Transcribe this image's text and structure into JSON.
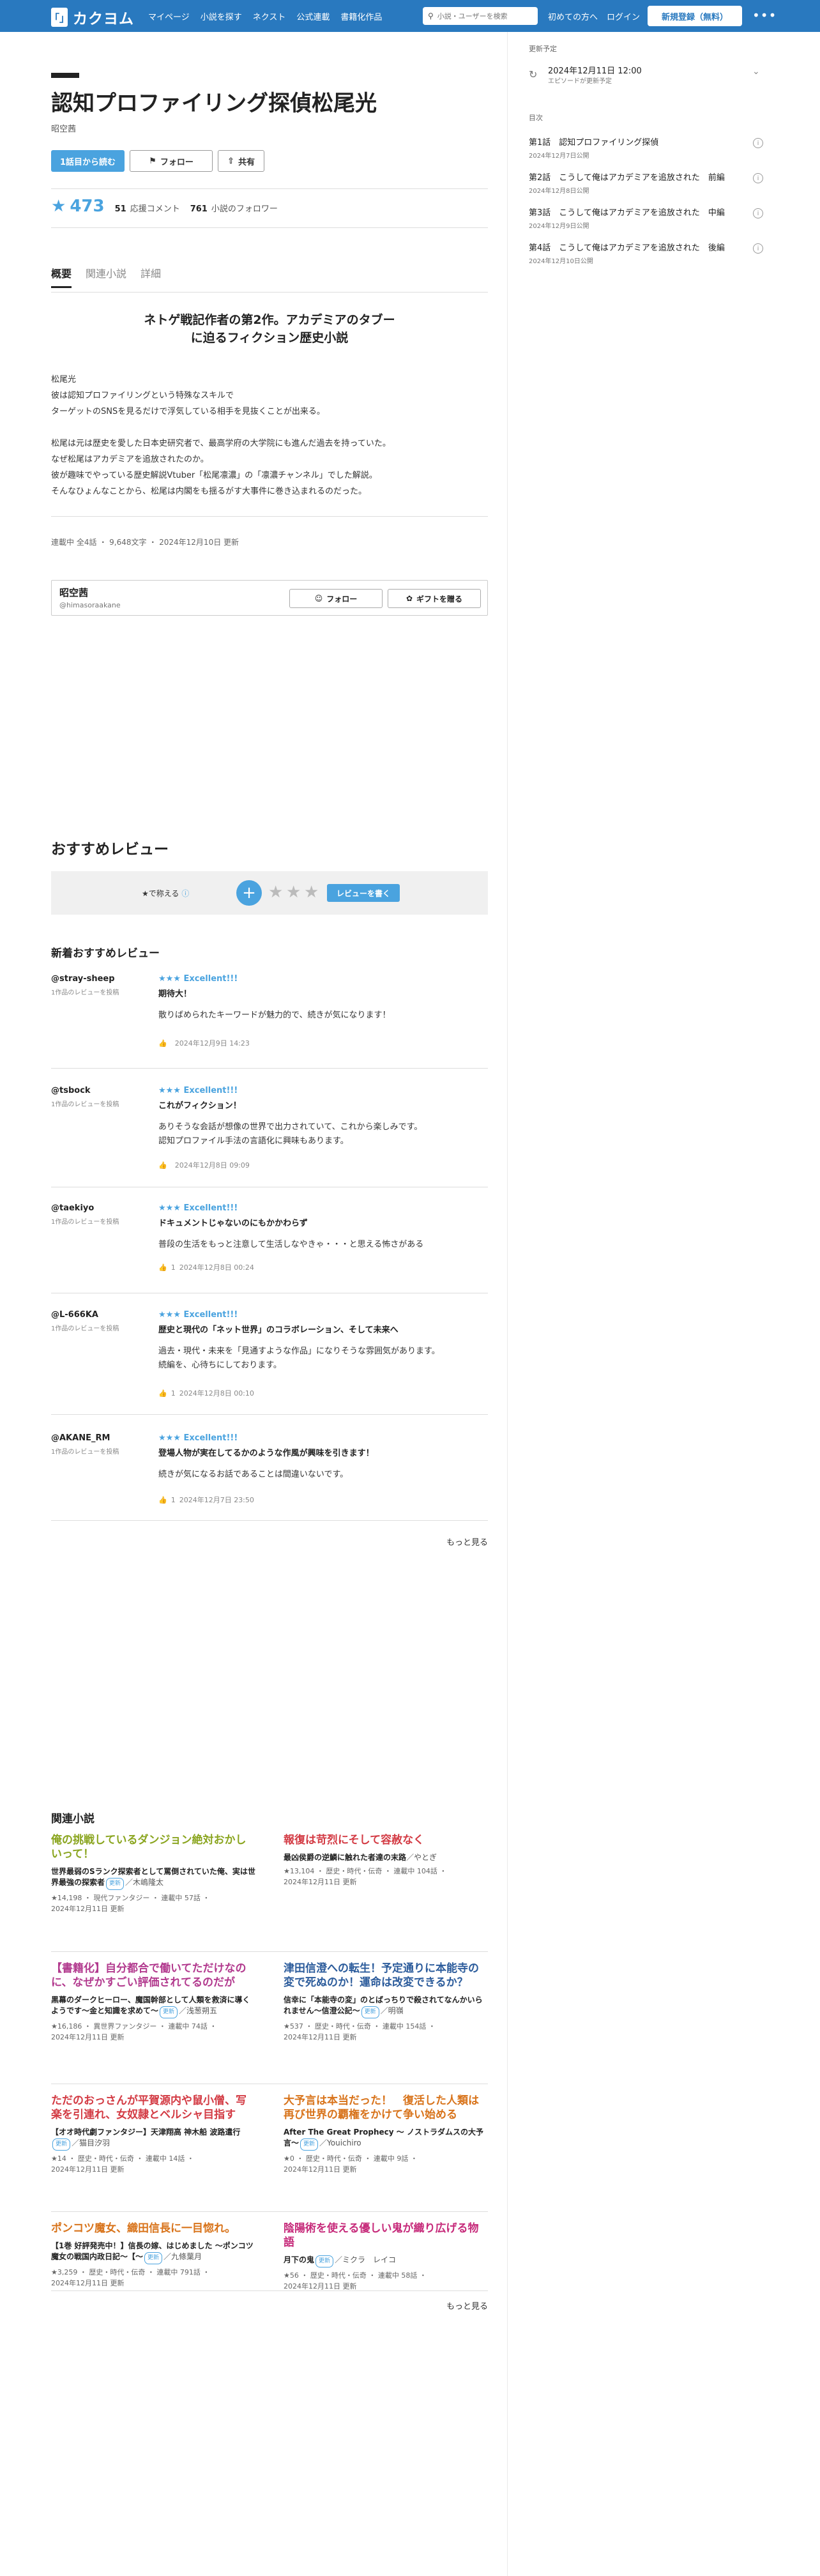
{
  "header": {
    "logo_mark": "「」",
    "logo_text": "カクヨム",
    "nav": [
      "マイページ",
      "小説を探す",
      "ネクスト",
      "公式連載",
      "書籍化作品"
    ],
    "search_placeholder": "小説・ユーザーを検索",
    "first_time": "初めての方へ",
    "login": "ログイン",
    "register": "新規登録（無料）",
    "more": "•••"
  },
  "work": {
    "title": "認知プロファイリング探偵松尾光",
    "author": "昭空茜",
    "read_first": "1話目から読む",
    "follow": "フォロー",
    "share": "共有",
    "score": "473",
    "comments_num": "51",
    "comments_label": "応援コメント",
    "followers_num": "761",
    "followers_label": "小説のフォロワー"
  },
  "tabs": [
    "概要",
    "関連小説",
    "詳細"
  ],
  "catch_line1": "ネトゲ戦記作者の第2作。アカデミアのタブー",
  "catch_line2": "に迫るフィクション歴史小説",
  "intro_lines": [
    "松尾光",
    "彼は認知プロファイリングという特殊なスキルで",
    "ターゲットのSNSを見るだけで浮気している相手を見抜くことが出来る。",
    "",
    "松尾は元は歴史を愛した日本史研究者で、最高学府の大学院にも進んだ過去を持っていた。",
    "なぜ松尾はアカデミアを追放されたのか。",
    "彼が趣味でやっている歴史解説Vtuber「松尾凛濃」の「凛濃チャンネル」でした解説。",
    "そんなひょんなことから、松尾は内閣をも揺るがす大事件に巻き込まれるのだった。"
  ],
  "meta": {
    "status": "連載中",
    "episodes": "全4話",
    "chars": "9,648文字",
    "updated": "2024年12月10日 更新"
  },
  "author_card": {
    "name": "昭空茜",
    "id": "@himasoraakane",
    "follow": "フォロー",
    "gift": "ギフトを贈る"
  },
  "recommend": {
    "title": "おすすめレビュー",
    "label": "★で称える",
    "write": "レビューを書く"
  },
  "new_reviews_title": "新着おすすめレビュー",
  "reviews": [
    {
      "user": "@stray-sheep",
      "count": "1作品のレビューを投稿",
      "rating": "★★★ Excellent!!!",
      "title": "期待大！",
      "body": [
        "散りばめられたキーワードが魅力的で、続きが気になります！"
      ],
      "likes": "",
      "date": "2024年12月9日 14:23"
    },
    {
      "user": "@tsbock",
      "count": "1作品のレビューを投稿",
      "rating": "★★★ Excellent!!!",
      "title": "これがフィクション！",
      "body": [
        "ありそうな会話が想像の世界で出力されていて、これから楽しみです。",
        "認知プロファイル手法の言語化に興味もあります。"
      ],
      "likes": "",
      "date": "2024年12月8日 09:09"
    },
    {
      "user": "@taekiyo",
      "count": "1作品のレビューを投稿",
      "rating": "★★★ Excellent!!!",
      "title": "ドキュメントじゃないのにもかかわらず",
      "body": [
        "普段の生活をもっと注意して生活しなやきゃ・・・と思える怖さがある"
      ],
      "likes": "1",
      "date": "2024年12月8日 00:24"
    },
    {
      "user": "@L-666KA",
      "count": "1作品のレビューを投稿",
      "rating": "★★★ Excellent!!!",
      "title": "歴史と現代の「ネット世界」のコラボレーション、そして未来へ",
      "body": [
        "過去・現代・未来を「見通すような作品」になりそうな雰囲気があります。",
        "続編を、心待ちにしております。"
      ],
      "likes": "1",
      "date": "2024年12月8日 00:10"
    },
    {
      "user": "@AKANE_RM",
      "count": "1作品のレビューを投稿",
      "rating": "★★★ Excellent!!!",
      "title": "登場人物が実在してるかのような作風が興味を引きます！",
      "body": [
        "続きが気になるお話であることは間違いないです。"
      ],
      "likes": "1",
      "date": "2024年12月7日 23:50"
    }
  ],
  "more": "もっと見る",
  "related": {
    "title": "関連小説",
    "items": [
      {
        "title": "俺の挑戦しているダンジョン絶対おかしいって！",
        "color": "#8aa51f",
        "desc": "世界最弱のSランク探索者として罵倒されていた俺、実は世界最強の探索者",
        "badge": "更新",
        "author": "／木嶋隆太",
        "meta1": "★14,198 ・ 現代ファンタジー ・ 連載中 57話 ・",
        "meta2": "2024年12月11日 更新"
      },
      {
        "title": "報復は苛烈にそして容赦なく",
        "color": "#d33a43",
        "desc": "最凶侯爵の逆鱗に触れた者達の末路",
        "badge": "",
        "author": "／やとぎ",
        "meta1": "★13,104 ・ 歴史・時代・伝奇 ・ 連載中 104話 ・",
        "meta2": "2024年12月11日 更新"
      },
      {
        "title": "【書籍化】自分都合で働いてただけなのに、なぜかすごい評価されてるのだが",
        "color": "#b23a8e",
        "desc": "黒幕のダークヒーロー、魔国幹部として人類を救済に導くようです〜金と知識を求めて〜",
        "badge": "更新",
        "author": "／浅葱朔五",
        "meta1": "★16,186 ・ 異世界ファンタジー ・ 連載中 74話 ・",
        "meta2": "2024年12月11日 更新"
      },
      {
        "title": "津田信澄への転生！予定通りに本能寺の変で死ぬのか！運命は改変できるか？",
        "color": "#2b5b9b",
        "desc": "信幸に「本能寺の変」のとばっちりで殺されてなんかいられません〜信澄公記〜",
        "badge": "更新",
        "author": "／明嶺",
        "meta1": "★537 ・ 歴史・時代・伝奇 ・ 連載中 154話 ・",
        "meta2": "2024年12月11日 更新"
      },
      {
        "title": "ただのおっさんが平賀源内や鼠小僧、写楽を引連れ、女奴隷とベルシャ目指す",
        "color": "#d33a43",
        "desc": "【オオ時代劇ファンタジー】天津翔高 神木船 波路遣行",
        "badge": "更新",
        "author": "／猫目汐羽",
        "meta1": "★14 ・ 歴史・時代・伝奇 ・ 連載中 14話 ・",
        "meta2": "2024年12月11日 更新"
      },
      {
        "title": "大予言は本当だった！　復活した人類は再び世界の覇権をかけて争い始める",
        "color": "#d8731a",
        "desc": "After The Great Prophecy 〜 ノストラダムスの大予言〜",
        "badge": "更新",
        "author": "／Youichiro",
        "meta1": "★0 ・ 歴史・時代・伝奇 ・ 連載中 9話 ・",
        "meta2": "2024年12月11日 更新"
      },
      {
        "title": "ポンコツ魔女、織田信長に一目惚れ。",
        "color": "#d8731a",
        "desc": "【1巻 好評発売中！】信長の嫁、はじめました 〜ポンコツ魔女の戦国内政日記〜【〜",
        "badge": "更新",
        "author": "／九條葉月",
        "meta1": "★3,259 ・ 歴史・時代・伝奇 ・ 連載中 791話 ・",
        "meta2": "2024年12月11日 更新"
      },
      {
        "title": "陰陽術を使える優しい鬼が織り広げる物語",
        "color": "#c62a7a",
        "desc": "月下の鬼",
        "badge": "更新",
        "author": "／ミクラ　レイコ",
        "meta1": "★56 ・ 歴史・時代・伝奇 ・ 連載中 58話 ・",
        "meta2": "2024年12月11日 更新"
      }
    ]
  },
  "sidebar": {
    "update_label": "更新予定",
    "update_date": "2024年12月11日 12:00",
    "update_sub": "エピソードが更新予定",
    "toc_label": "目次",
    "episodes": [
      {
        "title": "第1話　認知プロファイリング探偵",
        "date": "2024年12月7日公開"
      },
      {
        "title": "第2話　こうして俺はアカデミアを追放された　前編",
        "date": "2024年12月8日公開"
      },
      {
        "title": "第3話　こうして俺はアカデミアを追放された　中編",
        "date": "2024年12月9日公開"
      },
      {
        "title": "第4話　こうして俺はアカデミアを追放された　後編",
        "date": "2024年12月10日公開"
      }
    ]
  },
  "icons": {
    "search": "search-icon",
    "follow": "user-plus-icon",
    "share": "share-icon",
    "gift": "gift-icon",
    "like": "thumbs-up-icon",
    "info": "info-icon",
    "refresh": "refresh-icon"
  },
  "colors": {
    "brand": "#2979bf",
    "accent": "#4aa3df"
  }
}
